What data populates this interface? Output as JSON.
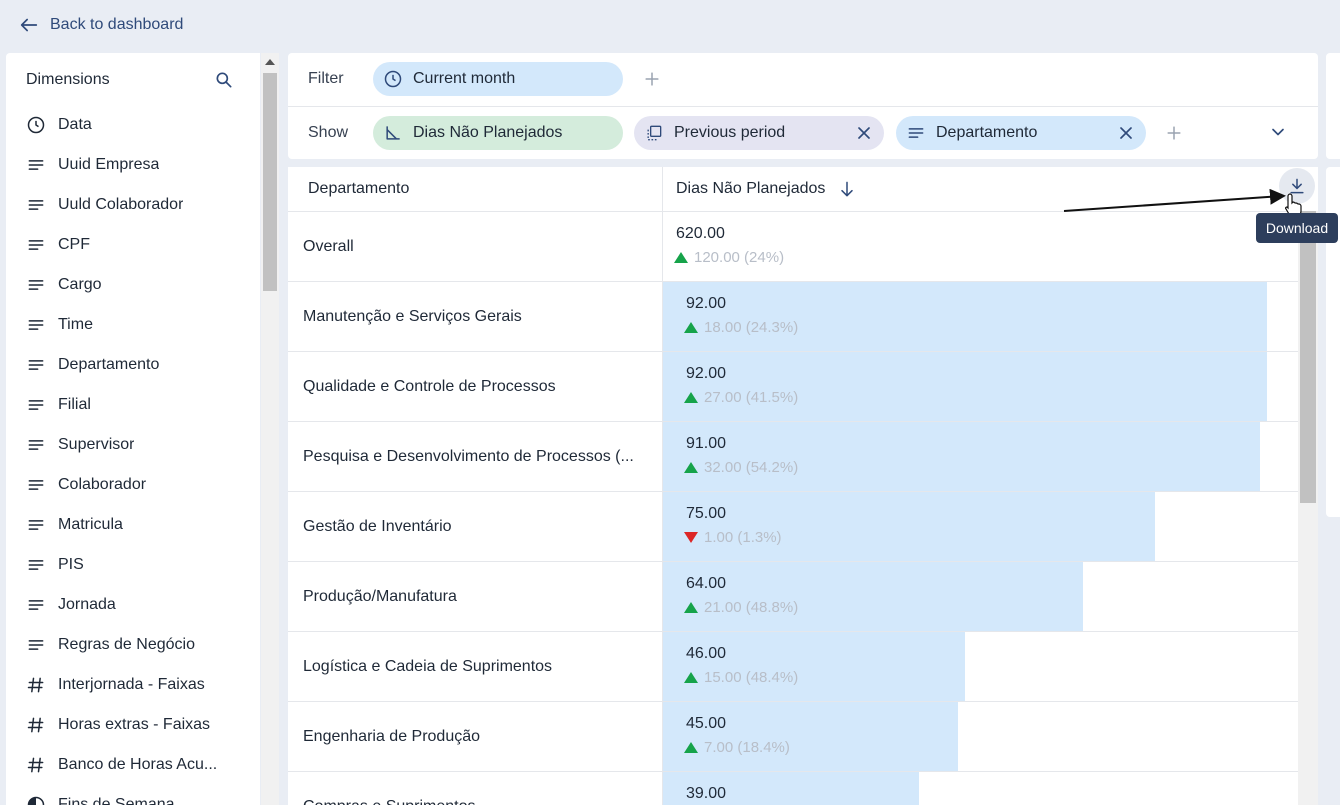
{
  "nav": {
    "back_label": "Back to dashboard"
  },
  "sidebar": {
    "title": "Dimensions",
    "items": [
      {
        "label": "Data",
        "icon": "clock-icon"
      },
      {
        "label": "Uuid Empresa",
        "icon": "text-lines-icon"
      },
      {
        "label": "Uuld Colaborador",
        "icon": "text-lines-icon"
      },
      {
        "label": "CPF",
        "icon": "text-lines-icon"
      },
      {
        "label": "Cargo",
        "icon": "text-lines-icon"
      },
      {
        "label": "Time",
        "icon": "text-lines-icon"
      },
      {
        "label": "Departamento",
        "icon": "text-lines-icon"
      },
      {
        "label": "Filial",
        "icon": "text-lines-icon"
      },
      {
        "label": "Supervisor",
        "icon": "text-lines-icon"
      },
      {
        "label": "Colaborador",
        "icon": "text-lines-icon"
      },
      {
        "label": "Matricula",
        "icon": "text-lines-icon"
      },
      {
        "label": "PIS",
        "icon": "text-lines-icon"
      },
      {
        "label": "Jornada",
        "icon": "text-lines-icon"
      },
      {
        "label": "Regras de Negócio",
        "icon": "text-lines-icon"
      },
      {
        "label": "Interjornada - Faixas",
        "icon": "hash-icon"
      },
      {
        "label": "Horas extras - Faixas",
        "icon": "hash-icon"
      },
      {
        "label": "Banco de Horas Acu...",
        "icon": "hash-icon"
      },
      {
        "label": "Fins de Semana",
        "icon": "half-circle-icon"
      }
    ]
  },
  "filter": {
    "label": "Filter",
    "chip": {
      "label": "Current month",
      "color": "#d3e8fb"
    }
  },
  "show": {
    "label": "Show",
    "chips": [
      {
        "label": "Dias Não Planejados",
        "color": "#d4ecdc"
      },
      {
        "label": "Previous period",
        "color": "#e4e4f2"
      },
      {
        "label": "Departamento",
        "color": "#d3e8fb"
      }
    ]
  },
  "table": {
    "col1_header": "Departamento",
    "col2_header": "Dias Não Planejados",
    "max_value": 92,
    "rows": [
      {
        "name": "Overall",
        "value": "620.00",
        "delta": "120.00 (24%)",
        "dir": "up",
        "bar": 0
      },
      {
        "name": "Manutenção e Serviços Gerais",
        "value": "92.00",
        "delta": "18.00 (24.3%)",
        "dir": "up",
        "bar": 92
      },
      {
        "name": "Qualidade e Controle de Processos",
        "value": "92.00",
        "delta": "27.00 (41.5%)",
        "dir": "up",
        "bar": 92
      },
      {
        "name": "Pesquisa e Desenvolvimento de Processos (...",
        "value": "91.00",
        "delta": "32.00 (54.2%)",
        "dir": "up",
        "bar": 91
      },
      {
        "name": "Gestão de Inventário",
        "value": "75.00",
        "delta": "1.00 (1.3%)",
        "dir": "down",
        "bar": 75
      },
      {
        "name": "Produção/Manufatura",
        "value": "64.00",
        "delta": "21.00 (48.8%)",
        "dir": "up",
        "bar": 64
      },
      {
        "name": "Logística e Cadeia de Suprimentos",
        "value": "46.00",
        "delta": "15.00 (48.4%)",
        "dir": "up",
        "bar": 46
      },
      {
        "name": "Engenharia de Produção",
        "value": "45.00",
        "delta": "7.00 (18.4%)",
        "dir": "up",
        "bar": 45
      },
      {
        "name": "Compras e Suprimentos",
        "value": "39.00",
        "delta": "",
        "dir": "up",
        "bar": 39
      }
    ]
  },
  "download": {
    "tooltip": "Download"
  },
  "colors": {
    "bar": "#d3e8fb",
    "up": "#16a34a",
    "down": "#dc2626",
    "tooltip_bg": "#2d3e5c"
  }
}
